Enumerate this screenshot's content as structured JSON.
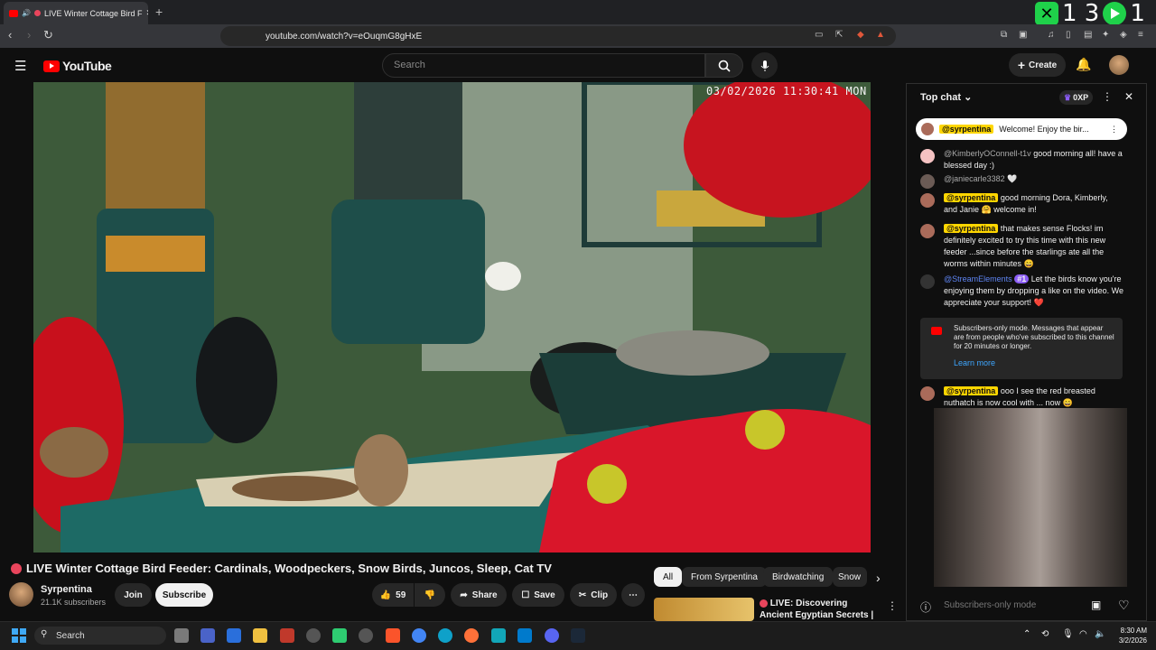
{
  "browser": {
    "tab_title": "LIVE Winter Cottage Bird F",
    "new_tab": "+",
    "url": "youtube.com/watch?v=eOuqmG8gHxE"
  },
  "overlay": {
    "left_number": "1 3",
    "right_number": "1"
  },
  "youtube": {
    "logo_text": "YouTube",
    "search_placeholder": "Search",
    "create_label": "Create"
  },
  "video": {
    "timestamp": "03/02/2026 11:30:41 MON",
    "title": "LIVE Winter Cottage Bird Feeder: Cardinals, Woodpeckers, Snow Birds, Juncos, Sleep, Cat TV",
    "channel": "Syrpentina",
    "subscribers": "21.1K subscribers",
    "join_label": "Join",
    "subscribe_label": "Subscribe",
    "likes": "59",
    "share_label": "Share",
    "save_label": "Save",
    "clip_label": "Clip"
  },
  "chips": [
    "All",
    "From Syrpentina",
    "Birdwatching",
    "Snow"
  ],
  "recommendation": {
    "title": "LIVE: Discovering Ancient Egyptian Secrets | Lost ..."
  },
  "chat": {
    "header": "Top chat",
    "xp_label": "0XP",
    "pinned_user": "@syrpentina",
    "pinned_text": "Welcome! Enjoy the bir...",
    "messages": [
      {
        "user": "@KimberlyOConnell-t1v",
        "text": "good morning all! have a blessed day :)"
      },
      {
        "user": "@janiecarle3382",
        "text": "🤍"
      },
      {
        "user": "@syrpentina",
        "text": "good morning Dora, Kimberly, and Janie 🤗 welcome in!"
      },
      {
        "user": "@syrpentina",
        "text": "that makes sense Flocks! im definitely excited to try this time with this new feeder ...since before the starlings ate all the worms within minutes 😄"
      },
      {
        "user": "@StreamElements",
        "badge": "#1",
        "text": "Let the birds know you're enjoying them by dropping a like on the video. We appreciate your support! ❤️"
      },
      {
        "user": "@syrpentina",
        "text": "ooo I see the red breasted nuthatch is now cool with ... now 😄"
      }
    ],
    "submode_text": "Subscribers-only mode. Messages that appear are from people who've subscribed to this channel for 20 minutes or longer.",
    "learn_more": "Learn more",
    "input_placeholder": "Subscribers-only mode"
  },
  "taskbar": {
    "search_label": "Search",
    "time": "8:30 AM",
    "date": "3/2/2026"
  }
}
